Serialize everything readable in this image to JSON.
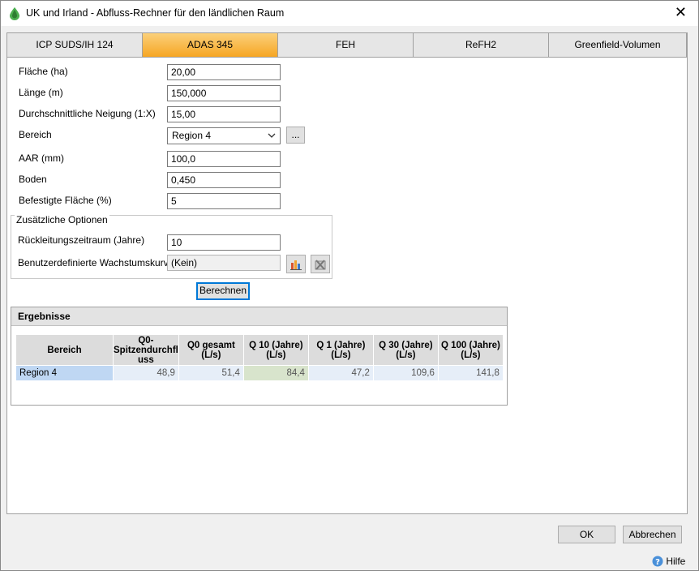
{
  "window": {
    "title": "UK und Irland - Abfluss-Rechner für den ländlichen Raum",
    "close_glyph": "✕"
  },
  "tabs": [
    {
      "label": "ICP SUDS/IH 124",
      "active": false
    },
    {
      "label": "ADAS 345",
      "active": true
    },
    {
      "label": "FEH",
      "active": false
    },
    {
      "label": "ReFH2",
      "active": false
    },
    {
      "label": "Greenfield-Volumen",
      "active": false
    }
  ],
  "form": {
    "flaeche_label": "Fläche (ha)",
    "flaeche_value": "20,00",
    "laenge_label": "Länge (m)",
    "laenge_value": "150,000",
    "neigung_label": "Durchschnittliche Neigung (1:X)",
    "neigung_value": "15,00",
    "bereich_label": "Bereich",
    "bereich_value": "Region 4",
    "bereich_more": "...",
    "aar_label": "AAR (mm)",
    "aar_value": "100,0",
    "boden_label": "Boden",
    "boden_value": "0,450",
    "befestigt_label": "Befestigte Fläche (%)",
    "befestigt_value": "5"
  },
  "options": {
    "group_title": "Zusätzliche Optionen",
    "rueck_label": "Rückleitungszeitraum (Jahre)",
    "rueck_value": "10",
    "kurve_label": "Benutzerdefinierte Wachstumskurve",
    "kurve_value": "(Kein)",
    "kurve_edit_icon": "chart-edit-icon",
    "kurve_clear_icon": "clear-curve-icon"
  },
  "actions": {
    "berechnen": "Berechnen"
  },
  "results": {
    "title": "Ergebnisse",
    "headers": [
      "Bereich",
      "Q0-Spitzendurchfluss",
      "Q0 gesamt (L/s)",
      "Q 10 (Jahre) (L/s)",
      "Q 1 (Jahre) (L/s)",
      "Q 30 (Jahre) (L/s)",
      "Q 100 (Jahre) (L/s)"
    ],
    "header_lines": [
      [
        "Bereich"
      ],
      [
        "Q0-",
        "Spitzendurchfl",
        "uss"
      ],
      [
        "Q0 gesamt",
        "(L/s)"
      ],
      [
        "Q 10 (Jahre)",
        "(L/s)"
      ],
      [
        "Q 1 (Jahre)",
        "(L/s)"
      ],
      [
        "Q 30 (Jahre)",
        "(L/s)"
      ],
      [
        "Q 100 (Jahre)",
        "(L/s)"
      ]
    ],
    "rows": [
      [
        "Region 4",
        "48,9",
        "51,4",
        "84,4",
        "47,2",
        "109,6",
        "141,8"
      ]
    ]
  },
  "footer": {
    "ok": "OK",
    "abbrechen": "Abbrechen",
    "hilfe": "Hilfe",
    "help_icon": "help-icon"
  },
  "colors": {
    "active_tab": "#f6a623",
    "accent_blue": "#0078d7",
    "title_icon": "#3a8a2e"
  }
}
